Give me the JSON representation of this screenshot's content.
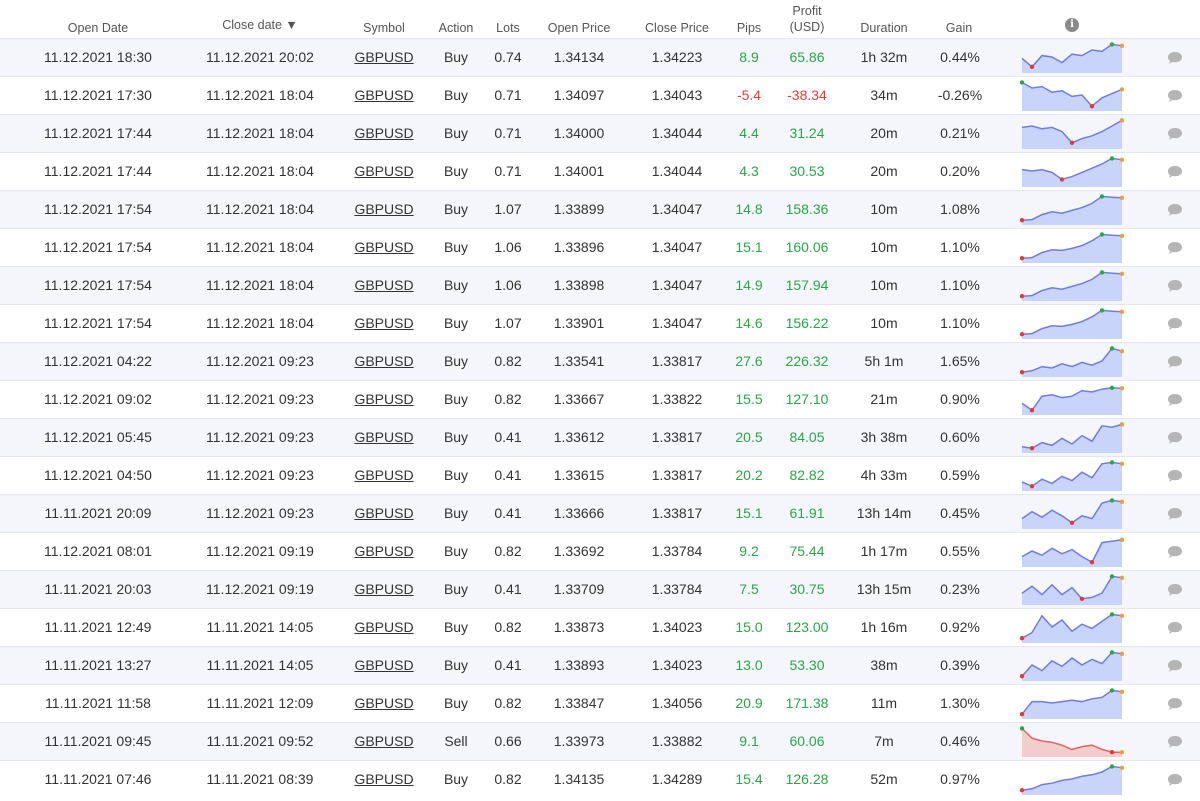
{
  "header": {
    "open_date": "Open Date",
    "close_date": "Close date ▼",
    "symbol": "Symbol",
    "action": "Action",
    "lots": "Lots",
    "open_price": "Open Price",
    "close_price": "Close Price",
    "pips": "Pips",
    "profit_line1": "Profit",
    "profit_line2": "(USD)",
    "duration": "Duration",
    "gain": "Gain",
    "info_icon": "info-icon"
  },
  "colors": {
    "positive": "#27a844",
    "negative": "#e53935",
    "spark_up_line": "#6f7ce3",
    "spark_up_fill": "#c9d4fb",
    "spark_down_line": "#e06666",
    "spark_down_fill": "#f3cccc"
  },
  "trades": [
    {
      "open": "11.12.2021 18:30",
      "close": "11.12.2021 20:02",
      "symbol": "GBPUSD",
      "action": "Buy",
      "lots": "0.74",
      "open_price": "1.34134",
      "close_price": "1.34223",
      "pips": "8.9",
      "profit": "65.86",
      "duration": "1h 32m",
      "gain": "0.44%",
      "neg": false,
      "spark": [
        0.45,
        0.15,
        0.55,
        0.5,
        0.3,
        0.6,
        0.55,
        0.75,
        0.7,
        0.95,
        0.9
      ]
    },
    {
      "open": "11.12.2021 17:30",
      "close": "11.12.2021 18:04",
      "symbol": "GBPUSD",
      "action": "Buy",
      "lots": "0.71",
      "open_price": "1.34097",
      "close_price": "1.34043",
      "pips": "-5.4",
      "profit": "-38.34",
      "duration": "34m",
      "gain": "-0.26%",
      "neg": true,
      "spark": [
        0.95,
        0.75,
        0.8,
        0.6,
        0.65,
        0.45,
        0.5,
        0.1,
        0.4,
        0.55,
        0.7
      ]
    },
    {
      "open": "11.12.2021 17:44",
      "close": "11.12.2021 18:04",
      "symbol": "GBPUSD",
      "action": "Buy",
      "lots": "0.71",
      "open_price": "1.34000",
      "close_price": "1.34044",
      "pips": "4.4",
      "profit": "31.24",
      "duration": "20m",
      "gain": "0.21%",
      "neg": false,
      "spark": [
        0.7,
        0.75,
        0.65,
        0.7,
        0.55,
        0.15,
        0.3,
        0.4,
        0.55,
        0.75,
        0.95
      ]
    },
    {
      "open": "11.12.2021 17:44",
      "close": "11.12.2021 18:04",
      "symbol": "GBPUSD",
      "action": "Buy",
      "lots": "0.71",
      "open_price": "1.34001",
      "close_price": "1.34044",
      "pips": "4.3",
      "profit": "30.53",
      "duration": "20m",
      "gain": "0.20%",
      "neg": false,
      "spark": [
        0.55,
        0.5,
        0.55,
        0.45,
        0.2,
        0.3,
        0.45,
        0.6,
        0.75,
        0.95,
        0.9
      ]
    },
    {
      "open": "11.12.2021 17:54",
      "close": "11.12.2021 18:04",
      "symbol": "GBPUSD",
      "action": "Buy",
      "lots": "1.07",
      "open_price": "1.33899",
      "close_price": "1.34047",
      "pips": "14.8",
      "profit": "158.36",
      "duration": "10m",
      "gain": "1.08%",
      "neg": false,
      "spark": [
        0.1,
        0.12,
        0.3,
        0.4,
        0.35,
        0.45,
        0.55,
        0.7,
        0.95,
        0.92,
        0.9
      ]
    },
    {
      "open": "11.12.2021 17:54",
      "close": "11.12.2021 18:04",
      "symbol": "GBPUSD",
      "action": "Buy",
      "lots": "1.06",
      "open_price": "1.33896",
      "close_price": "1.34047",
      "pips": "15.1",
      "profit": "160.06",
      "duration": "10m",
      "gain": "1.10%",
      "neg": false,
      "spark": [
        0.1,
        0.12,
        0.3,
        0.4,
        0.38,
        0.45,
        0.55,
        0.72,
        0.95,
        0.92,
        0.9
      ]
    },
    {
      "open": "11.12.2021 17:54",
      "close": "11.12.2021 18:04",
      "symbol": "GBPUSD",
      "action": "Buy",
      "lots": "1.06",
      "open_price": "1.33898",
      "close_price": "1.34047",
      "pips": "14.9",
      "profit": "157.94",
      "duration": "10m",
      "gain": "1.10%",
      "neg": false,
      "spark": [
        0.1,
        0.12,
        0.3,
        0.4,
        0.35,
        0.45,
        0.55,
        0.7,
        0.95,
        0.92,
        0.9
      ]
    },
    {
      "open": "11.12.2021 17:54",
      "close": "11.12.2021 18:04",
      "symbol": "GBPUSD",
      "action": "Buy",
      "lots": "1.07",
      "open_price": "1.33901",
      "close_price": "1.34047",
      "pips": "14.6",
      "profit": "156.22",
      "duration": "10m",
      "gain": "1.10%",
      "neg": false,
      "spark": [
        0.1,
        0.12,
        0.3,
        0.4,
        0.38,
        0.45,
        0.55,
        0.72,
        0.95,
        0.92,
        0.9
      ]
    },
    {
      "open": "11.12.2021 04:22",
      "close": "11.12.2021 09:23",
      "symbol": "GBPUSD",
      "action": "Buy",
      "lots": "0.82",
      "open_price": "1.33541",
      "close_price": "1.33817",
      "pips": "27.6",
      "profit": "226.32",
      "duration": "5h 1m",
      "gain": "1.65%",
      "neg": false,
      "spark": [
        0.1,
        0.15,
        0.3,
        0.25,
        0.4,
        0.3,
        0.45,
        0.35,
        0.5,
        0.95,
        0.85
      ]
    },
    {
      "open": "11.12.2021 09:02",
      "close": "11.12.2021 09:23",
      "symbol": "GBPUSD",
      "action": "Buy",
      "lots": "0.82",
      "open_price": "1.33667",
      "close_price": "1.33822",
      "pips": "15.5",
      "profit": "127.10",
      "duration": "21m",
      "gain": "0.90%",
      "neg": false,
      "spark": [
        0.35,
        0.1,
        0.6,
        0.65,
        0.55,
        0.6,
        0.8,
        0.75,
        0.85,
        0.9,
        0.88
      ]
    },
    {
      "open": "11.12.2021 05:45",
      "close": "11.12.2021 09:23",
      "symbol": "GBPUSD",
      "action": "Buy",
      "lots": "0.41",
      "open_price": "1.33612",
      "close_price": "1.33817",
      "pips": "20.5",
      "profit": "84.05",
      "duration": "3h 38m",
      "gain": "0.60%",
      "neg": false,
      "spark": [
        0.15,
        0.1,
        0.3,
        0.2,
        0.45,
        0.25,
        0.55,
        0.35,
        0.9,
        0.85,
        0.95
      ]
    },
    {
      "open": "11.12.2021 04:50",
      "close": "11.12.2021 09:23",
      "symbol": "GBPUSD",
      "action": "Buy",
      "lots": "0.41",
      "open_price": "1.33615",
      "close_price": "1.33817",
      "pips": "20.2",
      "profit": "82.82",
      "duration": "4h 33m",
      "gain": "0.59%",
      "neg": false,
      "spark": [
        0.25,
        0.1,
        0.35,
        0.2,
        0.45,
        0.3,
        0.6,
        0.4,
        0.9,
        0.95,
        0.9
      ]
    },
    {
      "open": "11.11.2021 20:09",
      "close": "11.12.2021 09:23",
      "symbol": "GBPUSD",
      "action": "Buy",
      "lots": "0.41",
      "open_price": "1.33666",
      "close_price": "1.33817",
      "pips": "15.1",
      "profit": "61.91",
      "duration": "13h 14m",
      "gain": "0.45%",
      "neg": false,
      "spark": [
        0.3,
        0.55,
        0.35,
        0.6,
        0.4,
        0.15,
        0.4,
        0.3,
        0.85,
        0.95,
        0.9
      ]
    },
    {
      "open": "11.12.2021 08:01",
      "close": "11.12.2021 09:19",
      "symbol": "GBPUSD",
      "action": "Buy",
      "lots": "0.82",
      "open_price": "1.33692",
      "close_price": "1.33784",
      "pips": "9.2",
      "profit": "75.44",
      "duration": "1h 17m",
      "gain": "0.55%",
      "neg": false,
      "spark": [
        0.3,
        0.5,
        0.35,
        0.6,
        0.4,
        0.55,
        0.3,
        0.1,
        0.8,
        0.85,
        0.9
      ]
    },
    {
      "open": "11.11.2021 20:03",
      "close": "11.12.2021 09:19",
      "symbol": "GBPUSD",
      "action": "Buy",
      "lots": "0.41",
      "open_price": "1.33709",
      "close_price": "1.33784",
      "pips": "7.5",
      "profit": "30.75",
      "duration": "13h 15m",
      "gain": "0.23%",
      "neg": false,
      "spark": [
        0.35,
        0.6,
        0.3,
        0.65,
        0.3,
        0.55,
        0.15,
        0.2,
        0.35,
        0.95,
        0.9
      ]
    },
    {
      "open": "11.11.2021 12:49",
      "close": "11.11.2021 14:05",
      "symbol": "GBPUSD",
      "action": "Buy",
      "lots": "0.82",
      "open_price": "1.33873",
      "close_price": "1.34023",
      "pips": "15.0",
      "profit": "123.00",
      "duration": "1h 16m",
      "gain": "0.92%",
      "neg": false,
      "spark": [
        0.1,
        0.3,
        0.9,
        0.5,
        0.75,
        0.35,
        0.6,
        0.45,
        0.7,
        0.95,
        0.9
      ]
    },
    {
      "open": "11.11.2021 13:27",
      "close": "11.11.2021 14:05",
      "symbol": "GBPUSD",
      "action": "Buy",
      "lots": "0.41",
      "open_price": "1.33893",
      "close_price": "1.34023",
      "pips": "13.0",
      "profit": "53.30",
      "duration": "38m",
      "gain": "0.39%",
      "neg": false,
      "spark": [
        0.1,
        0.5,
        0.3,
        0.65,
        0.45,
        0.75,
        0.5,
        0.7,
        0.55,
        0.95,
        0.9
      ]
    },
    {
      "open": "11.11.2021 11:58",
      "close": "11.11.2021 12:09",
      "symbol": "GBPUSD",
      "action": "Buy",
      "lots": "0.82",
      "open_price": "1.33847",
      "close_price": "1.34056",
      "pips": "20.9",
      "profit": "171.38",
      "duration": "11m",
      "gain": "1.30%",
      "neg": false,
      "spark": [
        0.1,
        0.55,
        0.55,
        0.5,
        0.55,
        0.6,
        0.55,
        0.65,
        0.7,
        0.95,
        0.9
      ]
    },
    {
      "open": "11.11.2021 09:45",
      "close": "11.11.2021 09:52",
      "symbol": "GBPUSD",
      "action": "Sell",
      "lots": "0.66",
      "open_price": "1.33973",
      "close_price": "1.33882",
      "pips": "9.1",
      "profit": "60.06",
      "duration": "7m",
      "gain": "0.46%",
      "neg": false,
      "down": true,
      "spark": [
        0.95,
        0.6,
        0.5,
        0.45,
        0.35,
        0.2,
        0.3,
        0.35,
        0.2,
        0.1,
        0.1
      ]
    },
    {
      "open": "11.11.2021 07:46",
      "close": "11.11.2021 08:39",
      "symbol": "GBPUSD",
      "action": "Buy",
      "lots": "0.82",
      "open_price": "1.34135",
      "close_price": "1.34289",
      "pips": "15.4",
      "profit": "126.28",
      "duration": "52m",
      "gain": "0.97%",
      "neg": false,
      "spark": [
        0.1,
        0.15,
        0.3,
        0.35,
        0.45,
        0.5,
        0.6,
        0.65,
        0.75,
        0.95,
        0.9
      ]
    }
  ]
}
